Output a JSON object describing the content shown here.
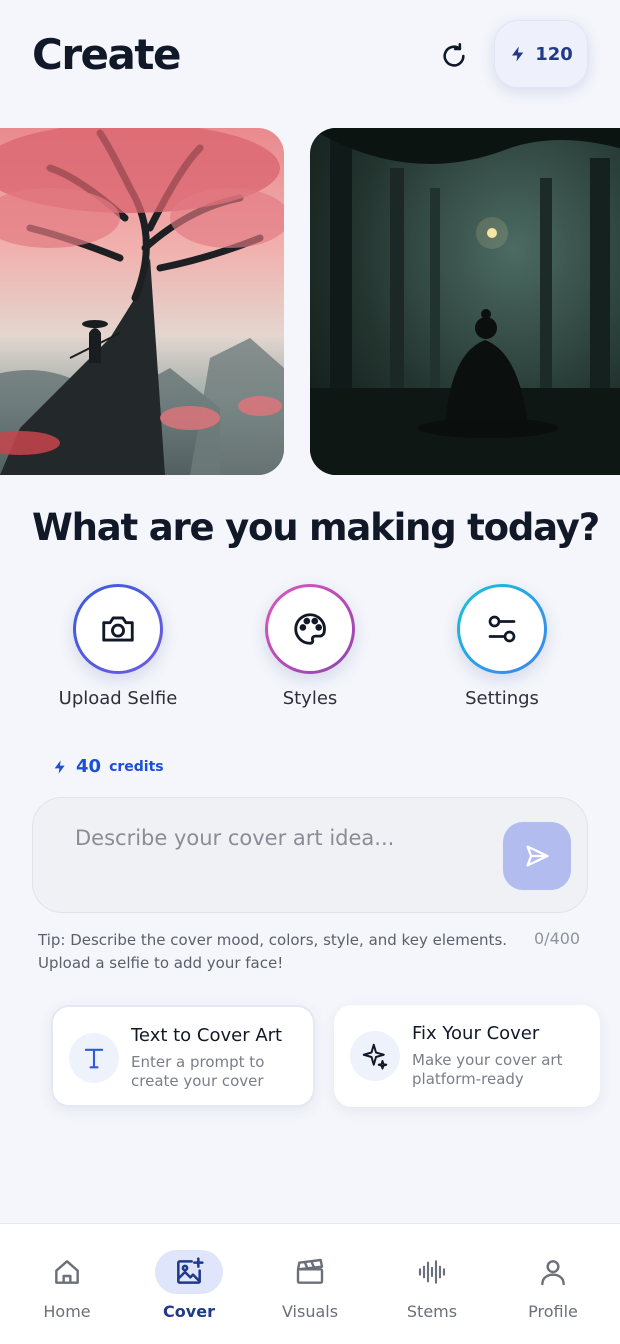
{
  "header": {
    "title": "Create",
    "credits": "120"
  },
  "carousel": {
    "items": [
      {
        "icon": "samurai-cherry-tree-image"
      },
      {
        "icon": "meditating-figure-forest-image"
      }
    ]
  },
  "main": {
    "heading": "What are you making today?",
    "actions": [
      {
        "label": "Upload Selfie",
        "icon": "camera-icon"
      },
      {
        "label": "Styles",
        "icon": "palette-icon"
      },
      {
        "label": "Settings",
        "icon": "sliders-icon"
      }
    ],
    "credits_count": "40",
    "credits_label": "credits",
    "prompt": {
      "placeholder": "Describe your cover art idea...",
      "value": ""
    },
    "tip": "Tip: Describe the cover mood, colors, style, and key elements. Upload a selfie to add your face!",
    "counter": "0/400",
    "features": [
      {
        "title": "Text to Cover Art",
        "description": "Enter a prompt to create your cover",
        "icon": "text-t-icon"
      },
      {
        "title": "Fix Your Cover",
        "description": "Make your cover art platform-ready",
        "icon": "sparkles-icon"
      }
    ]
  },
  "tabbar": {
    "tabs": [
      {
        "label": "Home",
        "icon": "home-icon"
      },
      {
        "label": "Cover",
        "icon": "image-plus-icon",
        "active": true
      },
      {
        "label": "Visuals",
        "icon": "clapperboard-icon"
      },
      {
        "label": "Stems",
        "icon": "waveform-icon"
      },
      {
        "label": "Profile",
        "icon": "user-icon"
      }
    ]
  },
  "colors": {
    "accent": "#1f3a8a",
    "background": "#f4f6fb",
    "send_button": "#b3bcef"
  }
}
